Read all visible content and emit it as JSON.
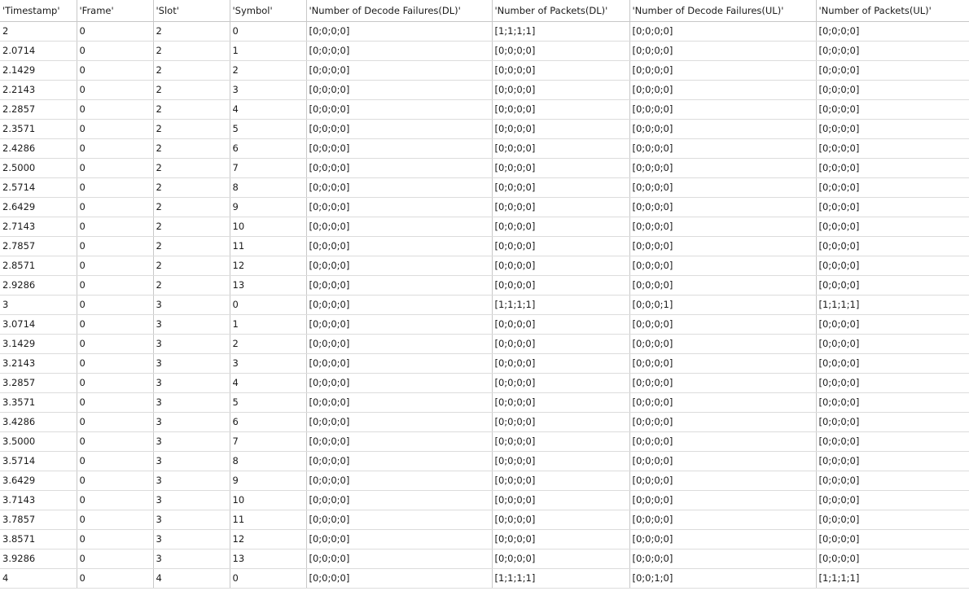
{
  "table": {
    "columns": [
      "'Timestamp'",
      "'Frame'",
      "'Slot'",
      "'Symbol'",
      "'Number of Decode Failures(DL)'",
      "'Number of Packets(DL)'",
      "'Number of Decode Failures(UL)'",
      "'Number of Packets(UL)'"
    ],
    "rows": [
      [
        "2",
        "0",
        "2",
        "0",
        "[0;0;0;0]",
        "[1;1;1;1]",
        "[0;0;0;0]",
        "[0;0;0;0]"
      ],
      [
        "2.0714",
        "0",
        "2",
        "1",
        "[0;0;0;0]",
        "[0;0;0;0]",
        "[0;0;0;0]",
        "[0;0;0;0]"
      ],
      [
        "2.1429",
        "0",
        "2",
        "2",
        "[0;0;0;0]",
        "[0;0;0;0]",
        "[0;0;0;0]",
        "[0;0;0;0]"
      ],
      [
        "2.2143",
        "0",
        "2",
        "3",
        "[0;0;0;0]",
        "[0;0;0;0]",
        "[0;0;0;0]",
        "[0;0;0;0]"
      ],
      [
        "2.2857",
        "0",
        "2",
        "4",
        "[0;0;0;0]",
        "[0;0;0;0]",
        "[0;0;0;0]",
        "[0;0;0;0]"
      ],
      [
        "2.3571",
        "0",
        "2",
        "5",
        "[0;0;0;0]",
        "[0;0;0;0]",
        "[0;0;0;0]",
        "[0;0;0;0]"
      ],
      [
        "2.4286",
        "0",
        "2",
        "6",
        "[0;0;0;0]",
        "[0;0;0;0]",
        "[0;0;0;0]",
        "[0;0;0;0]"
      ],
      [
        "2.5000",
        "0",
        "2",
        "7",
        "[0;0;0;0]",
        "[0;0;0;0]",
        "[0;0;0;0]",
        "[0;0;0;0]"
      ],
      [
        "2.5714",
        "0",
        "2",
        "8",
        "[0;0;0;0]",
        "[0;0;0;0]",
        "[0;0;0;0]",
        "[0;0;0;0]"
      ],
      [
        "2.6429",
        "0",
        "2",
        "9",
        "[0;0;0;0]",
        "[0;0;0;0]",
        "[0;0;0;0]",
        "[0;0;0;0]"
      ],
      [
        "2.7143",
        "0",
        "2",
        "10",
        "[0;0;0;0]",
        "[0;0;0;0]",
        "[0;0;0;0]",
        "[0;0;0;0]"
      ],
      [
        "2.7857",
        "0",
        "2",
        "11",
        "[0;0;0;0]",
        "[0;0;0;0]",
        "[0;0;0;0]",
        "[0;0;0;0]"
      ],
      [
        "2.8571",
        "0",
        "2",
        "12",
        "[0;0;0;0]",
        "[0;0;0;0]",
        "[0;0;0;0]",
        "[0;0;0;0]"
      ],
      [
        "2.9286",
        "0",
        "2",
        "13",
        "[0;0;0;0]",
        "[0;0;0;0]",
        "[0;0;0;0]",
        "[0;0;0;0]"
      ],
      [
        "3",
        "0",
        "3",
        "0",
        "[0;0;0;0]",
        "[1;1;1;1]",
        "[0;0;0;1]",
        "[1;1;1;1]"
      ],
      [
        "3.0714",
        "0",
        "3",
        "1",
        "[0;0;0;0]",
        "[0;0;0;0]",
        "[0;0;0;0]",
        "[0;0;0;0]"
      ],
      [
        "3.1429",
        "0",
        "3",
        "2",
        "[0;0;0;0]",
        "[0;0;0;0]",
        "[0;0;0;0]",
        "[0;0;0;0]"
      ],
      [
        "3.2143",
        "0",
        "3",
        "3",
        "[0;0;0;0]",
        "[0;0;0;0]",
        "[0;0;0;0]",
        "[0;0;0;0]"
      ],
      [
        "3.2857",
        "0",
        "3",
        "4",
        "[0;0;0;0]",
        "[0;0;0;0]",
        "[0;0;0;0]",
        "[0;0;0;0]"
      ],
      [
        "3.3571",
        "0",
        "3",
        "5",
        "[0;0;0;0]",
        "[0;0;0;0]",
        "[0;0;0;0]",
        "[0;0;0;0]"
      ],
      [
        "3.4286",
        "0",
        "3",
        "6",
        "[0;0;0;0]",
        "[0;0;0;0]",
        "[0;0;0;0]",
        "[0;0;0;0]"
      ],
      [
        "3.5000",
        "0",
        "3",
        "7",
        "[0;0;0;0]",
        "[0;0;0;0]",
        "[0;0;0;0]",
        "[0;0;0;0]"
      ],
      [
        "3.5714",
        "0",
        "3",
        "8",
        "[0;0;0;0]",
        "[0;0;0;0]",
        "[0;0;0;0]",
        "[0;0;0;0]"
      ],
      [
        "3.6429",
        "0",
        "3",
        "9",
        "[0;0;0;0]",
        "[0;0;0;0]",
        "[0;0;0;0]",
        "[0;0;0;0]"
      ],
      [
        "3.7143",
        "0",
        "3",
        "10",
        "[0;0;0;0]",
        "[0;0;0;0]",
        "[0;0;0;0]",
        "[0;0;0;0]"
      ],
      [
        "3.7857",
        "0",
        "3",
        "11",
        "[0;0;0;0]",
        "[0;0;0;0]",
        "[0;0;0;0]",
        "[0;0;0;0]"
      ],
      [
        "3.8571",
        "0",
        "3",
        "12",
        "[0;0;0;0]",
        "[0;0;0;0]",
        "[0;0;0;0]",
        "[0;0;0;0]"
      ],
      [
        "3.9286",
        "0",
        "3",
        "13",
        "[0;0;0;0]",
        "[0;0;0;0]",
        "[0;0;0;0]",
        "[0;0;0;0]"
      ],
      [
        "4",
        "0",
        "4",
        "0",
        "[0;0;0;0]",
        "[1;1;1;1]",
        "[0;0;1;0]",
        "[1;1;1;1]"
      ]
    ]
  }
}
